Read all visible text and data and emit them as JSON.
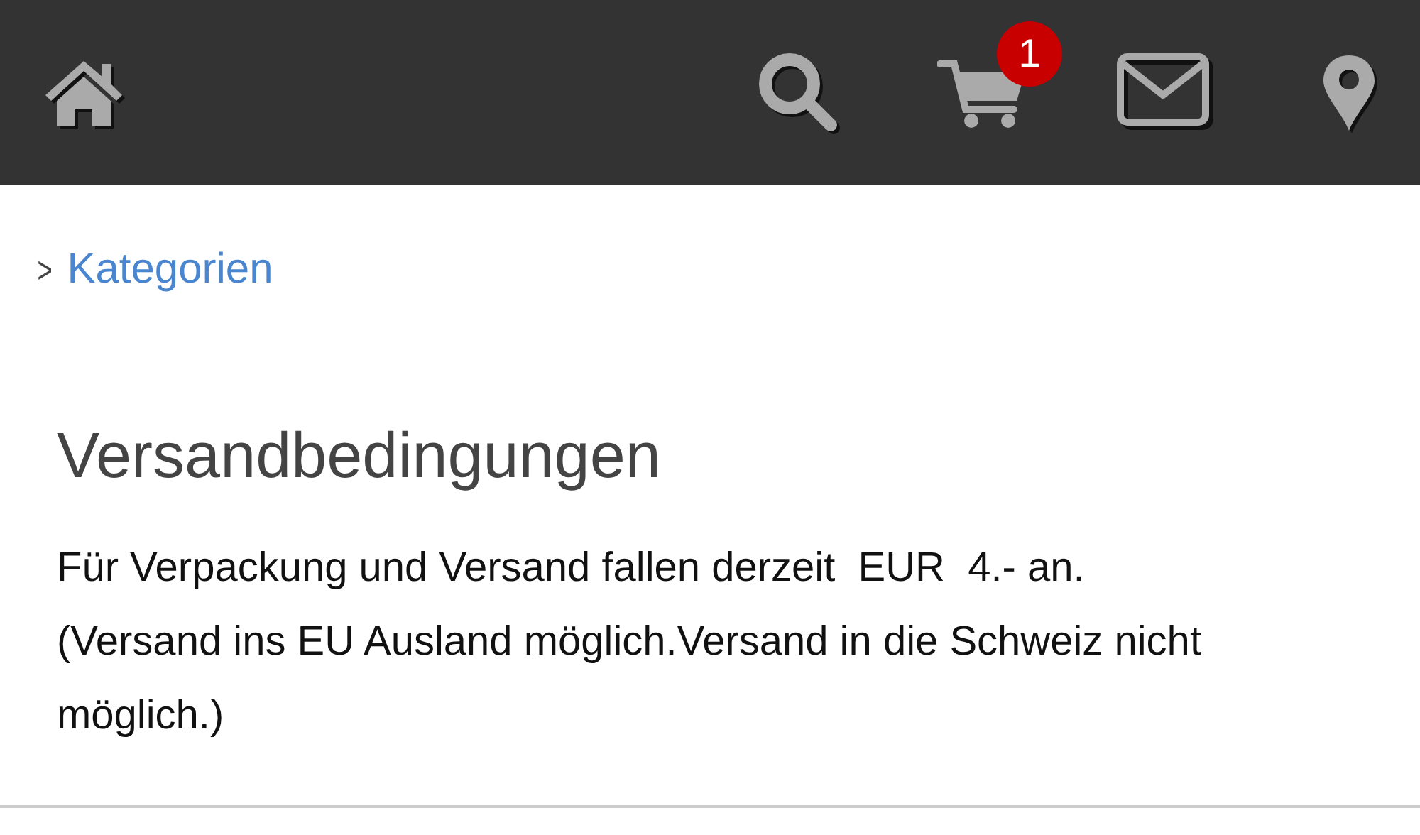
{
  "header": {
    "icons": [
      {
        "kind": "home"
      },
      {
        "kind": "search"
      },
      {
        "kind": "cart",
        "badge": "1"
      },
      {
        "kind": "mail"
      },
      {
        "kind": "location"
      }
    ]
  },
  "breadcrumb": {
    "chevron": ">",
    "label": "Kategorien"
  },
  "content": {
    "title": "Versandbedingungen",
    "text": "Für Verpackung und Versand fallen derzeit  EUR  4.- an.\n(Versand ins EU Ausland möglich.Versand in die Schweiz nicht möglich.)"
  }
}
